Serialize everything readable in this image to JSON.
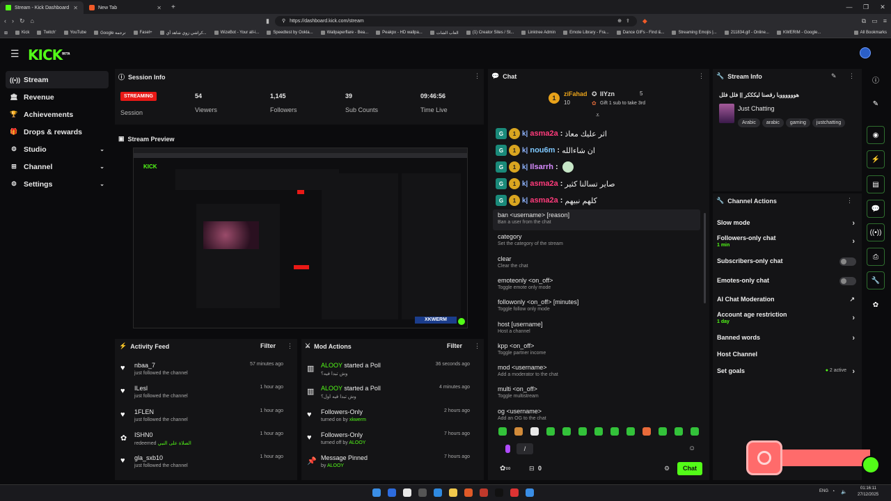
{
  "browser": {
    "tabs": [
      {
        "title": "Stream - Kick Dashboard",
        "active": true
      },
      {
        "title": "New Tab",
        "active": false
      }
    ],
    "url": "https://dashboard.kick.com/stream",
    "bookmarks": [
      "Kick",
      "Twitch'",
      "YouTube",
      "Google ترجمة",
      "Fasel+",
      "كراشي زوي شاهد أي...",
      "WizeBot - Your all-i...",
      "Speedtest by Ookla...",
      "Wallpaperflare - Bea...",
      "Peakpx - HD wallpa...",
      "العاب الشات",
      "(1) Creator Sites / St...",
      "Linktree Admin",
      "Emote Library - Fra...",
      "Dance GIFs - Find &...",
      "Streaming Emojis |...",
      "211834.gif - Online...",
      "KWERIM - Google...",
      "All Bookmarks"
    ]
  },
  "app": {
    "logo": "KICK",
    "logo_tag": "BETA"
  },
  "sidebar": {
    "items": [
      {
        "label": "Stream",
        "icon": "signal-icon",
        "active": true,
        "has_chevron": false
      },
      {
        "label": "Revenue",
        "icon": "bank-icon",
        "active": false,
        "has_chevron": false
      },
      {
        "label": "Achievements",
        "icon": "trophy-icon",
        "active": false,
        "has_chevron": false
      },
      {
        "label": "Drops & rewards",
        "icon": "gift-icon",
        "active": false,
        "has_chevron": false
      },
      {
        "label": "Studio",
        "icon": "gear-icon",
        "active": false,
        "has_chevron": true
      },
      {
        "label": "Channel",
        "icon": "channel-icon",
        "active": false,
        "has_chevron": true
      },
      {
        "label": "Settings",
        "icon": "settings-icon",
        "active": false,
        "has_chevron": true
      }
    ]
  },
  "session": {
    "title": "Session Info",
    "status_badge": "STREAMING",
    "status_label": "Session",
    "stats": [
      {
        "value": "54",
        "label": "Viewers"
      },
      {
        "value": "1,145",
        "label": "Followers"
      },
      {
        "value": "39",
        "label": "Sub Counts"
      },
      {
        "value": "09:46:56",
        "label": "Time Live"
      }
    ]
  },
  "preview": {
    "title": "Stream Preview",
    "overlay_text": "XKWERM"
  },
  "activity_feed": {
    "title": "Activity Feed",
    "filter_label": "Filter",
    "items": [
      {
        "name": "nbaa_7",
        "desc": "just followed the channel",
        "time": "57 minutes ago",
        "icon": "heart-icon"
      },
      {
        "name": "ILesl",
        "desc": "just followed the channel",
        "time": "1 hour ago",
        "icon": "heart-icon"
      },
      {
        "name": "1FLEN",
        "desc": "just followed the channel",
        "time": "1 hour ago",
        "icon": "heart-icon"
      },
      {
        "name": "ISHN0",
        "desc": "redeemed",
        "extra": "الصلاة على النبي",
        "time": "1 hour ago",
        "icon": "reward-icon"
      },
      {
        "name": "gla_sxb10",
        "desc": "just followed the channel",
        "time": "1 hour ago",
        "icon": "heart-icon"
      }
    ]
  },
  "mod_actions": {
    "title": "Mod Actions",
    "filter_label": "Filter",
    "items": [
      {
        "title_user": "ALOOY",
        "title_rest": "started a Poll",
        "desc": "وش تبدا فيه؟",
        "time": "36 seconds ago",
        "icon": "poll-icon"
      },
      {
        "title_user": "ALOOY",
        "title_rest": "started a Poll",
        "desc": "وش تبدا فيه اول؟",
        "time": "4 minutes ago",
        "icon": "poll-icon"
      },
      {
        "title_user": "",
        "title_rest": "Followers-Only",
        "desc_pre": "turned on by",
        "desc_user": "xkwerm",
        "time": "2 hours ago",
        "icon": "heart-icon"
      },
      {
        "title_user": "",
        "title_rest": "Followers-Only",
        "desc_pre": "turned off by",
        "desc_user": "ALOOY",
        "time": "7 hours ago",
        "icon": "heart-icon"
      },
      {
        "title_user": "",
        "title_rest": "Message Pinned",
        "desc_pre": "by",
        "desc_user": "ALOOY",
        "time": "7 hours ago",
        "icon": "pin-icon"
      }
    ]
  },
  "chat": {
    "title": "Chat",
    "leaderboard": [
      {
        "name": "ziFahad",
        "count": "10"
      },
      {
        "name": "IIYzn",
        "count": "5"
      }
    ],
    "gift_text": "Gift 1 sub to take 3rd",
    "messages": [
      {
        "user": "asma2a",
        "text": "اثر عليك معاذ",
        "user_color": "#ff3b7b"
      },
      {
        "user": "nou6m",
        "text": "ان شاءالله",
        "user_color": "#7ec8ff"
      },
      {
        "user": "Ilsarrh",
        "text": "",
        "user_color": "#d88bff"
      },
      {
        "user": "asma2a",
        "text": "صاير تسالنا كثير",
        "user_color": "#ff3b7b"
      },
      {
        "user": "asma2a",
        "text": "كلهم نبيهم",
        "user_color": "#ff3b7b"
      }
    ],
    "commands": [
      {
        "name": "ban <username> [reason]",
        "desc": "Ban a user from the chat"
      },
      {
        "name": "category",
        "desc": "Set the category of the stream"
      },
      {
        "name": "clear",
        "desc": "Clear the chat"
      },
      {
        "name": "emoteonly <on_off>",
        "desc": "Toggle emote only mode"
      },
      {
        "name": "followonly <on_off> [minutes]",
        "desc": "Toggle follow only mode"
      },
      {
        "name": "host [username]",
        "desc": "Host a channel"
      },
      {
        "name": "kpp <on_off>",
        "desc": "Toggle partner income"
      },
      {
        "name": "mod <username>",
        "desc": "Add a moderator to the chat"
      },
      {
        "name": "multi <on_off>",
        "desc": "Toggle multistream"
      },
      {
        "name": "og <username>",
        "desc": "Add an OG to the chat"
      }
    ],
    "input_value": "/",
    "points": "0",
    "send_label": "Chat"
  },
  "stream_info": {
    "title": "Stream Info",
    "stream_title": "هووووووبا رقصنا ليكككر || فلل فلل",
    "category": "Just Chatting",
    "tags": [
      "Arabic",
      "arabic",
      "gaming",
      "justchatting"
    ]
  },
  "channel_actions": {
    "title": "Channel Actions",
    "items": [
      {
        "label": "Slow mode",
        "sub": "",
        "control": "chevron"
      },
      {
        "label": "Followers-only chat",
        "sub": "1 min",
        "control": "chevron"
      },
      {
        "label": "Subscribers-only chat",
        "sub": "",
        "control": "toggle"
      },
      {
        "label": "Emotes-only chat",
        "sub": "",
        "control": "toggle"
      },
      {
        "label": "AI Chat Moderation",
        "sub": "",
        "control": "external"
      },
      {
        "label": "Account age restriction",
        "sub": "1 day",
        "control": "chevron"
      },
      {
        "label": "Banned words",
        "sub": "",
        "control": "chevron"
      },
      {
        "label": "Host Channel",
        "sub": "",
        "control": "none"
      },
      {
        "label": "Set goals",
        "sub": "",
        "control": "chevron",
        "badge": "2 active"
      }
    ]
  },
  "taskbar": {
    "lang": "ENG",
    "time": "01:16:11",
    "date": "27/12/2025"
  },
  "colors": {
    "accent": "#53fc18",
    "live_red": "#e91916",
    "panel": "#141416",
    "background": "#0b0b0d"
  }
}
